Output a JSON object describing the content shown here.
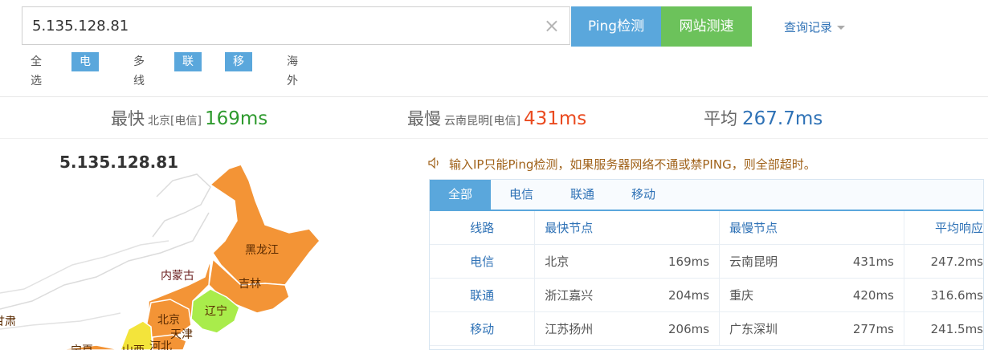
{
  "search": {
    "value": "5.135.128.81",
    "clear_icon": "×"
  },
  "buttons": {
    "ping": "Ping检测",
    "speed": "网站测速"
  },
  "history": {
    "label": "查询记录"
  },
  "filters": [
    {
      "label": "全选",
      "active": false
    },
    {
      "label": "电信",
      "active": true
    },
    {
      "label": "多线",
      "active": false
    },
    {
      "label": "联通",
      "active": true
    },
    {
      "label": "移动",
      "active": true
    },
    {
      "label": "海外",
      "active": false
    }
  ],
  "stats": {
    "fastest": {
      "label": "最快",
      "location": "北京[电信]",
      "value": "169ms",
      "color": "#2e9a2e"
    },
    "slowest": {
      "label": "最慢",
      "location": "云南昆明[电信]",
      "value": "431ms",
      "color": "#ea4a1f"
    },
    "average": {
      "label": "平均",
      "value": "267.7ms",
      "color": "#2f72b6"
    }
  },
  "map": {
    "ip": "5.135.128.81",
    "provinces": [
      "黑龙江",
      "吉林",
      "辽宁",
      "内蒙古",
      "北京",
      "天津",
      "河北",
      "山西",
      "宁夏",
      "甘肃"
    ]
  },
  "notice": {
    "text": "输入IP只能Ping检测，如果服务器网络不通或禁PING，则全部超时。",
    "icon": "speaker-icon"
  },
  "tabs": [
    "全部",
    "电信",
    "联通",
    "移动"
  ],
  "table": {
    "headers": [
      "线路",
      "最快节点",
      "最慢节点",
      "平均响应"
    ],
    "rows": [
      {
        "line": "电信",
        "fast_node": "北京",
        "fast_ms": "169ms",
        "slow_node": "云南昆明",
        "slow_ms": "431ms",
        "avg": "247.2ms"
      },
      {
        "line": "联通",
        "fast_node": "浙江嘉兴",
        "fast_ms": "204ms",
        "slow_node": "重庆",
        "slow_ms": "420ms",
        "avg": "316.6ms"
      },
      {
        "line": "移动",
        "fast_node": "江苏扬州",
        "fast_ms": "206ms",
        "slow_node": "广东深圳",
        "slow_ms": "277ms",
        "avg": "241.5ms"
      }
    ]
  }
}
